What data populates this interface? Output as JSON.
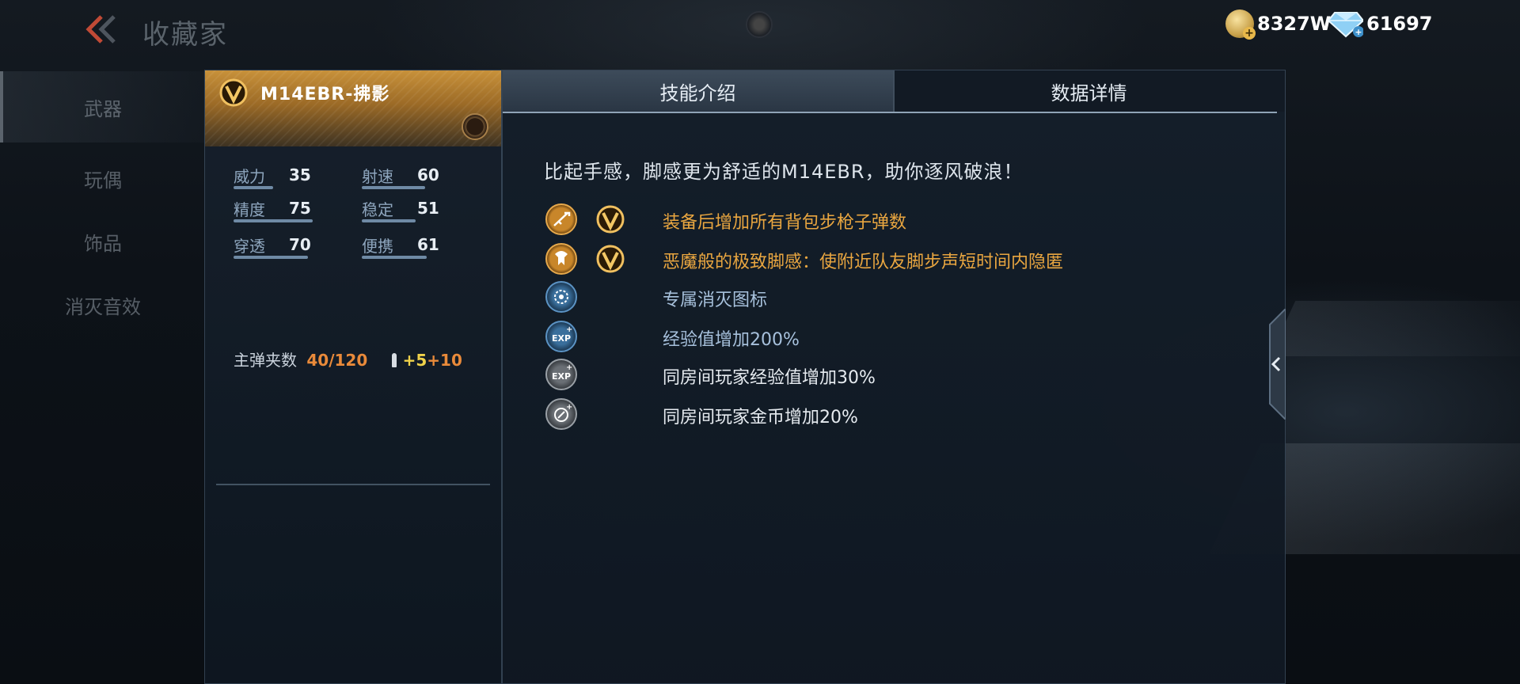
{
  "header": {
    "title": "收藏家",
    "back_icon": "double-chevron-left-icon",
    "gold_amount": "8327W",
    "diamond_amount": "61697"
  },
  "left_nav": {
    "items": [
      {
        "label": "武器",
        "active": true
      },
      {
        "label": "玩偶",
        "active": false
      },
      {
        "label": "饰品",
        "active": false
      },
      {
        "label": "消灭音效",
        "active": false
      }
    ]
  },
  "weapon": {
    "name": "M14EBR-拂影",
    "stats": {
      "power_label": "威力",
      "power": "35",
      "rate_label": "射速",
      "rate": "60",
      "accuracy_label": "精度",
      "accuracy": "75",
      "stability_label": "稳定",
      "stability": "51",
      "penetration_label": "穿透",
      "penetration": "70",
      "portability_label": "便携",
      "portability": "61"
    },
    "ammo_label": "主弹夹数",
    "ammo_value": "40/120",
    "ammo_bonus_a": "+5",
    "ammo_bonus_b": "+10"
  },
  "tabs": {
    "skill": "技能介绍",
    "data": "数据详情",
    "active": "skill"
  },
  "skills": {
    "description": "比起手感，脚感更为舒适的M14EBR，助你逐风破浪！",
    "items": [
      {
        "text": "装备后增加所有背包步枪子弹数",
        "icon": "rifle-icon",
        "color": "gold",
        "vip": true
      },
      {
        "text": "恶魔般的极致脚感：使附近队友脚步声短时间内隐匿",
        "icon": "footstep-icon",
        "color": "gold",
        "vip": true
      },
      {
        "text": "专属消灭图标",
        "icon": "kill-emblem-icon",
        "color": "blue",
        "vip": false
      },
      {
        "text": "经验值增加200%",
        "icon": "exp-plus-icon",
        "color": "blue",
        "vip": false
      },
      {
        "text": "同房间玩家经验值增加30%",
        "icon": "room-exp-icon",
        "color": "gray",
        "vip": false
      },
      {
        "text": "同房间玩家金币增加20%",
        "icon": "room-coin-icon",
        "color": "gray",
        "vip": false
      }
    ]
  },
  "colors": {
    "gold_text": "#e9a640",
    "blue_text": "#a7c1dc",
    "ammo_orange": "#e98a3a",
    "ammo_yellow": "#f0d24a",
    "stat_bar": "#6f8aa5"
  }
}
